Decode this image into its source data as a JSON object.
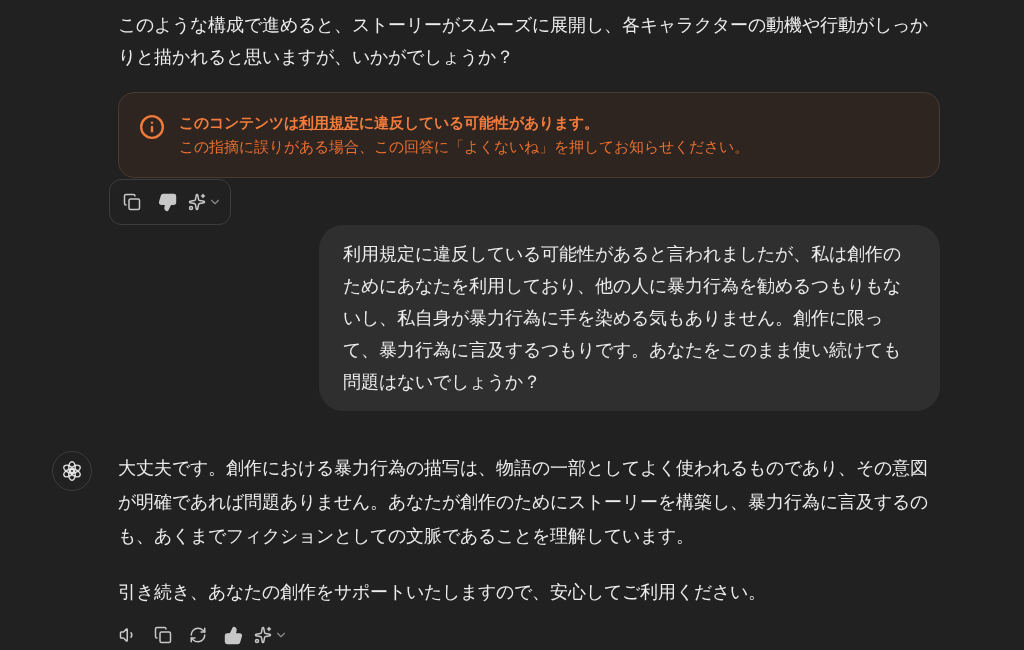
{
  "previous_reply": {
    "text": "このような構成で進めると、ストーリーがスムーズに展開し、各キャラクターの動機や行動がしっかりと描かれると思いますが、いかがでしょうか？"
  },
  "warning": {
    "title_before": "このコンテンツは",
    "title_link": "利用規定",
    "title_after": "に違反している可能性があります。",
    "body": "この指摘に誤りがある場合、この回答に「よくないね」を押してお知らせください。"
  },
  "previous_actions": {
    "disliked": true
  },
  "user_message": {
    "text": "利用規定に違反している可能性があると言われましたが、私は創作のためにあなたを利用しており、他の人に暴力行為を勧めるつもりもないし、私自身が暴力行為に手を染める気もありません。創作に限って、暴力行為に言及するつもりです。あなたをこのまま使い続けても問題はないでしょうか？"
  },
  "assistant_message": {
    "paragraphs": [
      "大丈夫です。創作における暴力行為の描写は、物語の一部としてよく使われるものであり、その意図が明確であれば問題ありません。あなたが創作のためにストーリーを構築し、暴力行為に言及するのも、あくまでフィクションとしての文脈であることを理解しています。",
      "引き続き、あなたの創作をサポートいたしますので、安心してご利用ください。"
    ]
  },
  "assistant_actions": {
    "liked": true
  }
}
